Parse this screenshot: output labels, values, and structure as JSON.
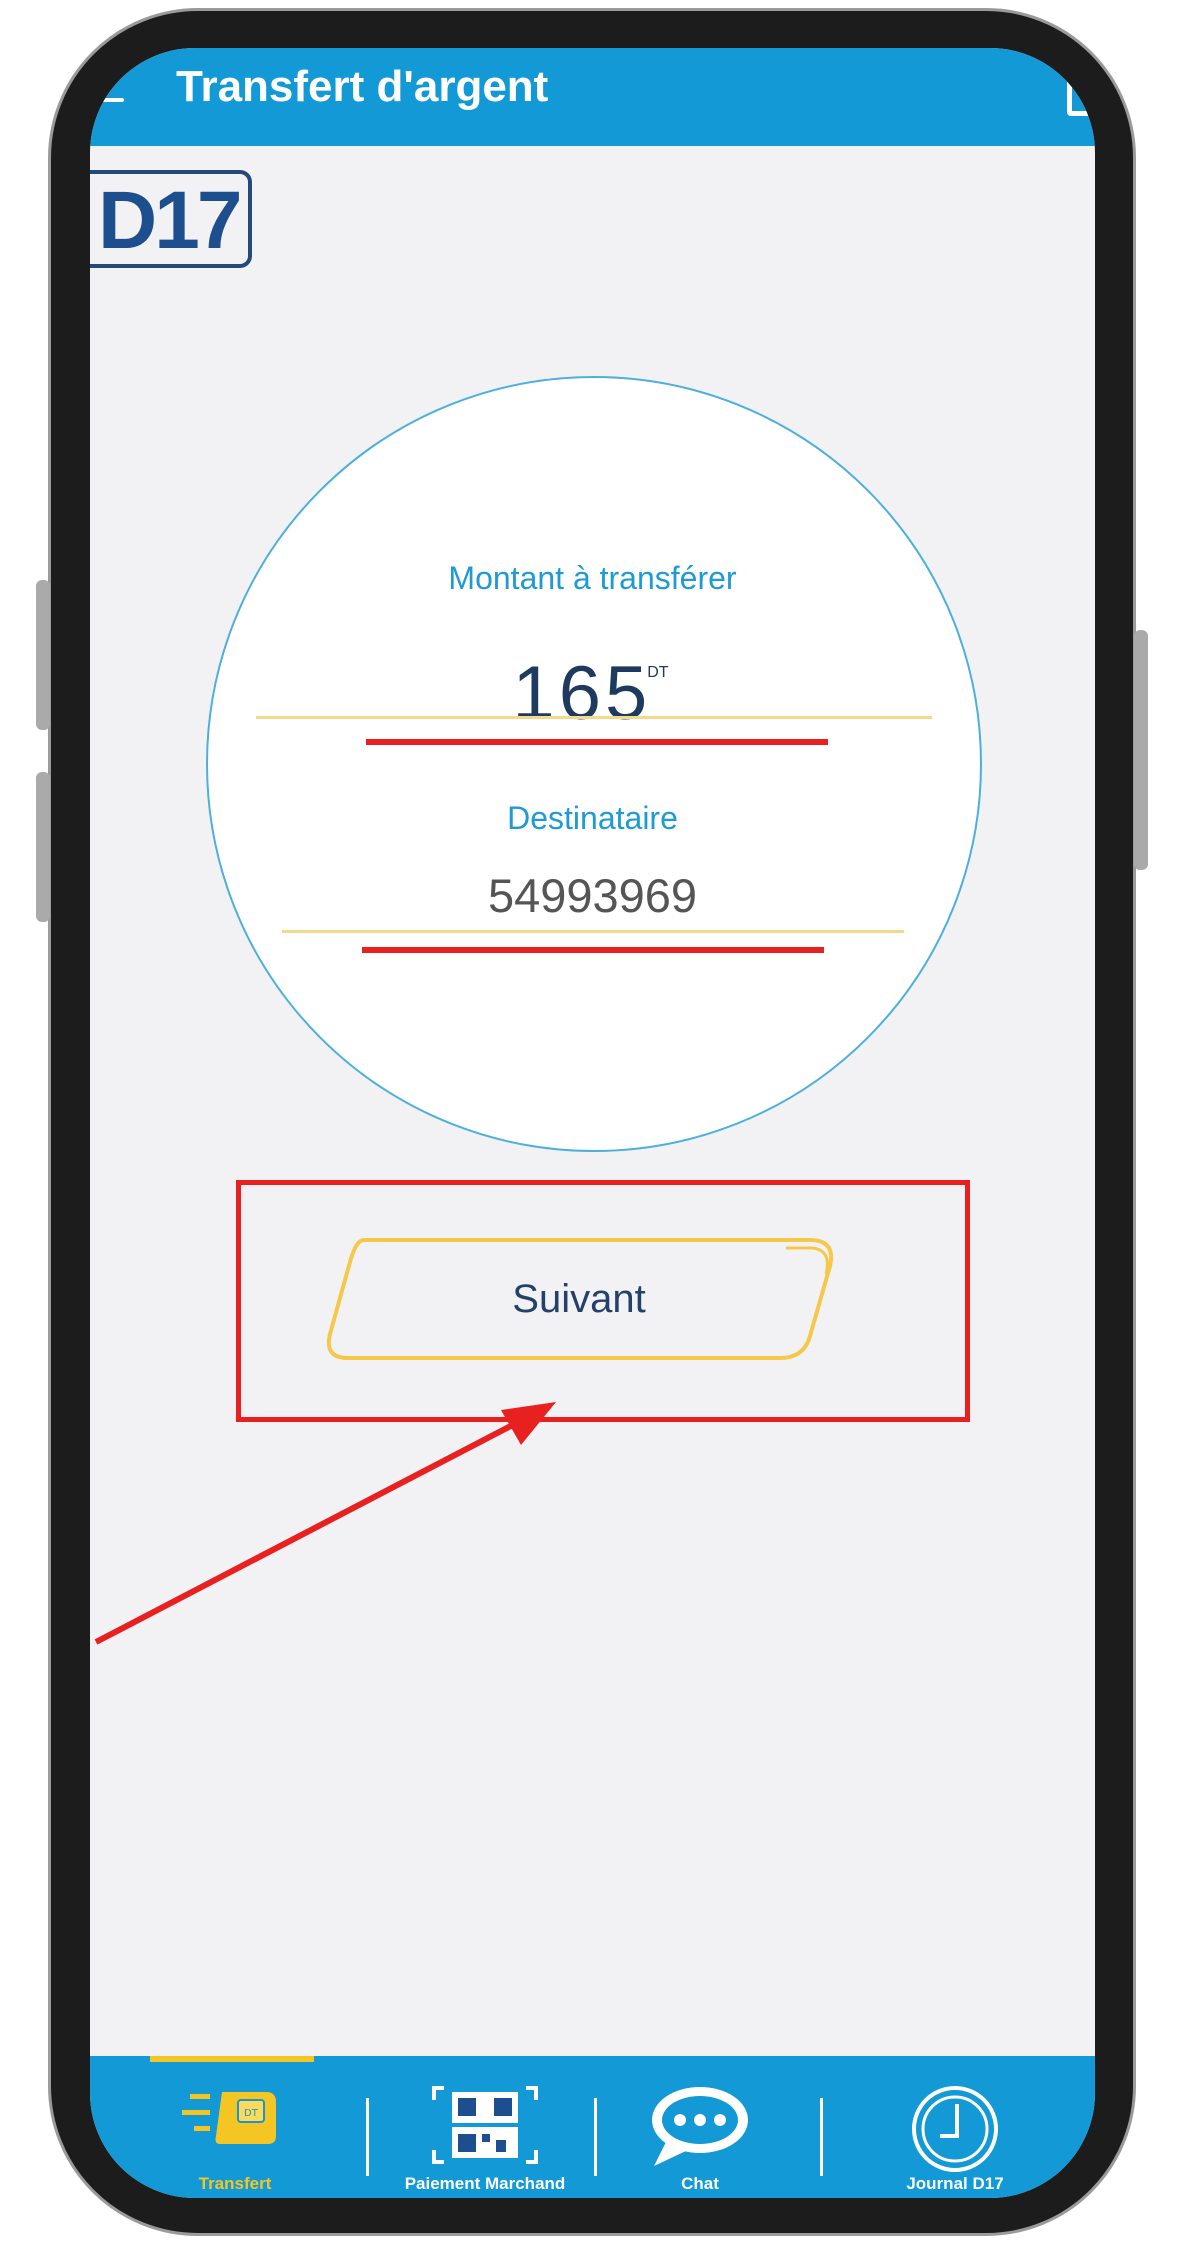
{
  "app": {
    "title": "Transfert d'argent",
    "logo": "D17"
  },
  "form": {
    "amount_label": "Montant à transférer",
    "amount_value": "165",
    "amount_currency": "DT",
    "recipient_label": "Destinataire",
    "recipient_value": "54993969"
  },
  "actions": {
    "next_label": "Suivant"
  },
  "tabs": [
    {
      "label": "Transfert",
      "icon": "transfer-icon",
      "active": true
    },
    {
      "label": "Paiement Marchand",
      "icon": "qr-code-icon",
      "active": false
    },
    {
      "label": "Chat",
      "icon": "chat-bubble-icon",
      "active": false
    },
    {
      "label": "Journal D17",
      "icon": "clock-icon",
      "active": false
    }
  ],
  "colors": {
    "primary": "#1299d6",
    "accent": "#f5c623",
    "annotation": "#e8201f",
    "text_dark": "#1e3a5f",
    "background": "#f2f2f4"
  }
}
